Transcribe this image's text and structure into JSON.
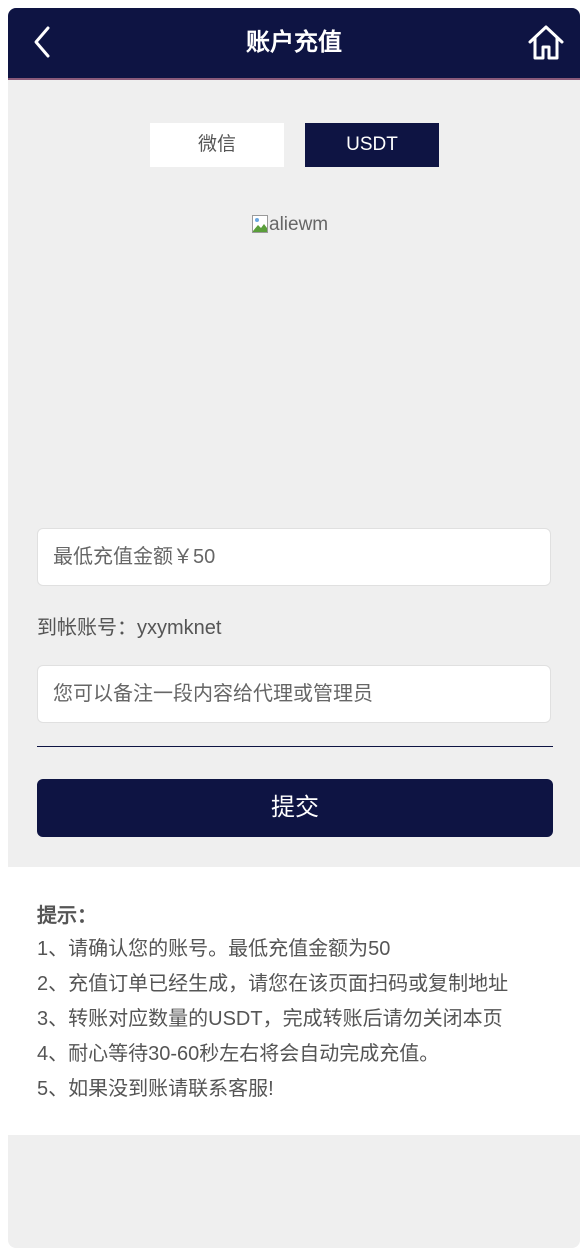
{
  "header": {
    "title": "账户充值"
  },
  "tabs": [
    {
      "label": "微信",
      "active": false
    },
    {
      "label": "USDT",
      "active": true
    }
  ],
  "qr_image": {
    "alt": "aliewm"
  },
  "amount_input": {
    "value": "",
    "placeholder": "最低充值金额￥50"
  },
  "account": {
    "label": "到帐账号：",
    "value": "yxymknet"
  },
  "note_input": {
    "value": "",
    "placeholder": "您可以备注一段内容给代理或管理员"
  },
  "submit_label": "提交",
  "tips": {
    "title": "提示：",
    "items": [
      "1、请确认您的账号。最低充值金额为50",
      "2、充值订单已经生成，请您在该页面扫码或复制地址",
      "3、转账对应数量的USDT，完成转账后请勿关闭本页",
      "4、耐心等待30-60秒左右将会自动完成充值。",
      "5、如果没到账请联系客服!"
    ]
  },
  "colors": {
    "primary": "#0e1443",
    "background": "#efefef",
    "text": "#555555"
  },
  "icons": {
    "back": "chevron-left-icon",
    "home": "home-icon",
    "broken_image": "broken-image-icon"
  }
}
